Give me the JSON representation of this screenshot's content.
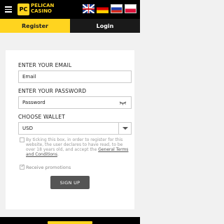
{
  "header": {
    "logo_badge": "PC",
    "logo_line1": "PELICAN",
    "logo_line2": "CASINO",
    "languages": [
      "English",
      "Deutsch",
      "Русский",
      "Polski"
    ]
  },
  "tabs": {
    "register": "Register",
    "login": "Login"
  },
  "form": {
    "email_label": "ENTER YOUR EMAIL",
    "email_placeholder": "Email",
    "password_label": "ENTER YOUR PASSWORD",
    "password_placeholder": "Password",
    "wallet_label": "CHOOSE WALLET",
    "wallet_value": "USD",
    "terms_text": "By ticking this box, in order to register for this website, the user declares to have read, to be over 18 years old, and accept the ",
    "terms_link": "General Terms and Conditions",
    "terms_end": ".",
    "terms_checked": false,
    "promo_label": "Receive promotions",
    "promo_checked": true,
    "signup_label": "SIGN UP"
  },
  "colors": {
    "accent": "#ffd41f",
    "dark": "#000000",
    "button": "#555555"
  },
  "icons": {
    "menu": "hamburger-icon",
    "password_toggle": "eye-closed-icon",
    "dropdown": "chevron-down-icon",
    "check": "checkmark-icon"
  }
}
